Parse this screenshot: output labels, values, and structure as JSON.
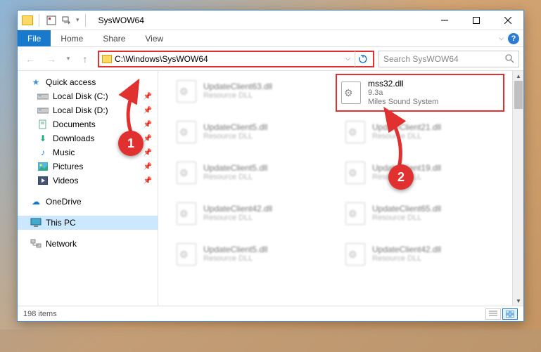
{
  "window": {
    "title": "SysWOW64"
  },
  "ribbon": {
    "file": "File",
    "tabs": [
      "Home",
      "Share",
      "View"
    ]
  },
  "nav": {
    "path": "C:\\Windows\\SysWOW64",
    "search_placeholder": "Search SysWOW64"
  },
  "sidebar": {
    "quick_access": "Quick access",
    "items": [
      {
        "label": "Local Disk (C:)",
        "icon": "drive",
        "pinned": true
      },
      {
        "label": "Local Disk (D:)",
        "icon": "drive",
        "pinned": true
      },
      {
        "label": "Documents",
        "icon": "docs",
        "pinned": true
      },
      {
        "label": "Downloads",
        "icon": "downloads",
        "pinned": true
      },
      {
        "label": "Music",
        "icon": "music",
        "pinned": true
      },
      {
        "label": "Pictures",
        "icon": "pictures",
        "pinned": true
      },
      {
        "label": "Videos",
        "icon": "videos",
        "pinned": true
      }
    ],
    "onedrive": "OneDrive",
    "thispc": "This PC",
    "network": "Network"
  },
  "files": {
    "col1": [
      {
        "name": "UpdateClient63.dll",
        "sub": "Resource DLL"
      },
      {
        "name": "UpdateClient5.dll",
        "sub": "Resource DLL"
      },
      {
        "name": "UpdateClient5.dll",
        "sub": "Resource DLL"
      },
      {
        "name": "UpdateClient42.dll",
        "sub": "Resource DLL"
      },
      {
        "name": "UpdateClient5.dll",
        "sub": "Resource DLL"
      }
    ],
    "highlight": {
      "name": "mss32.dll",
      "ver": "9.3a",
      "sub": "Miles Sound System"
    },
    "col2": [
      {
        "name": "UpdateClient21.dll",
        "sub": "Resource DLL"
      },
      {
        "name": "UpdateClient19.dll",
        "sub": "Resource DLL"
      },
      {
        "name": "UpdateClient65.dll",
        "sub": "Resource DLL"
      },
      {
        "name": "UpdateClient42.dll",
        "sub": "Resource DLL"
      }
    ]
  },
  "status": {
    "count": "198 items"
  },
  "callouts": {
    "one": "1",
    "two": "2"
  }
}
